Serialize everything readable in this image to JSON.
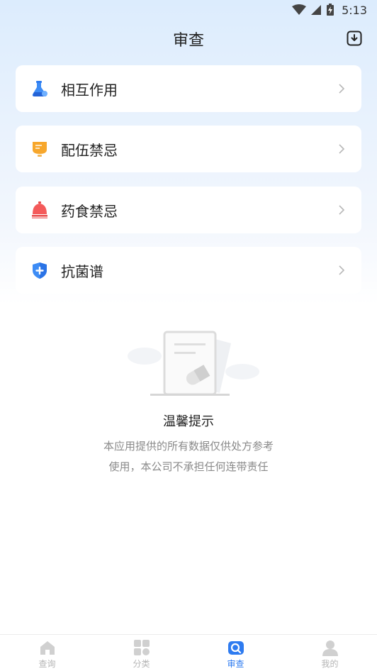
{
  "status_bar": {
    "time": "5:13"
  },
  "header": {
    "title": "审查"
  },
  "cards": [
    {
      "label": "相互作用",
      "icon": "flask-icon"
    },
    {
      "label": "配伍禁忌",
      "icon": "cup-icon"
    },
    {
      "label": "药食禁忌",
      "icon": "bell-icon"
    },
    {
      "label": "抗菌谱",
      "icon": "shield-plus-icon"
    }
  ],
  "notice": {
    "title": "温馨提示",
    "line1": "本应用提供的所有数据仅供处方参考",
    "line2": "使用，本公司不承担任何连带责任"
  },
  "tabbar": {
    "active": "审查",
    "tabs": [
      {
        "label": "查询",
        "icon": "home-icon"
      },
      {
        "label": "分类",
        "icon": "grid-icon"
      },
      {
        "label": "审查",
        "icon": "review-icon"
      },
      {
        "label": "我的",
        "icon": "user-icon"
      }
    ]
  },
  "colors": {
    "accent": "#2e7bf0",
    "card_bg": "#ffffff",
    "inactive_tab": "#b5b5b5"
  }
}
